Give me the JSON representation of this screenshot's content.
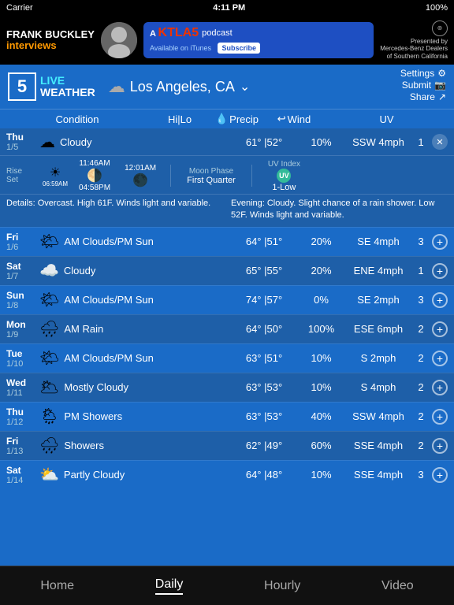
{
  "statusBar": {
    "carrier": "Carrier",
    "time": "4:11 PM",
    "battery": "100%"
  },
  "banner": {
    "frankBuckley": "FRANK BUCKLEY",
    "interviews": "interviews",
    "podcast": "podcast",
    "availableOn": "Available on iTunes",
    "subscribe": "Subscribe",
    "ktla": "KTLA",
    "presented": "Presented by",
    "mercedes": "Mercedes-Benz Dealers",
    "southern": "of Southern California"
  },
  "liveWeather": {
    "channel": "5",
    "live": "LIVE",
    "weather": "WEATHER",
    "location": "Los Angeles, CA",
    "settings": "Settings",
    "submit": "Submit",
    "share": "Share"
  },
  "columns": {
    "condition": "Condition",
    "hilo": "Hi|Lo",
    "precip": "Precip",
    "wind": "Wind",
    "uv": "UV"
  },
  "today": {
    "dayName": "Thu",
    "dayDate": "1/5",
    "condition": "Cloudy",
    "hiLo": "61° |52°",
    "precip": "10%",
    "wind": "SSW 4mph",
    "uv": "1",
    "sunrise": "06:59AM",
    "sunset": "04:58PM",
    "moonrise": "11:46AM",
    "moonset": "12:01AM",
    "moonPhase": "Moon Phase",
    "moonPhaseType": "First Quarter",
    "uvIndex": "UV Index",
    "uvValue": "1-Low"
  },
  "details": {
    "morning": "Details: Overcast. High 61F. Winds light and variable.",
    "evening": "Evening: Cloudy. Slight chance of a rain shower. Low 52F. Winds light and variable."
  },
  "forecast": [
    {
      "dayName": "Fri",
      "dayDate": "1/6",
      "condition": "AM Clouds/PM Sun",
      "icon": "🌤",
      "hiLo": "64° |51°",
      "precip": "20%",
      "wind": "SE 4mph",
      "uv": "3"
    },
    {
      "dayName": "Sat",
      "dayDate": "1/7",
      "condition": "Cloudy",
      "icon": "☁️",
      "hiLo": "65° |55°",
      "precip": "20%",
      "wind": "ENE 4mph",
      "uv": "1"
    },
    {
      "dayName": "Sun",
      "dayDate": "1/8",
      "condition": "AM Clouds/PM Sun",
      "icon": "🌤",
      "hiLo": "74° |57°",
      "precip": "0%",
      "wind": "SE 2mph",
      "uv": "3"
    },
    {
      "dayName": "Mon",
      "dayDate": "1/9",
      "condition": "AM Rain",
      "icon": "🌧",
      "hiLo": "64° |50°",
      "precip": "100%",
      "wind": "ESE 6mph",
      "uv": "2"
    },
    {
      "dayName": "Tue",
      "dayDate": "1/10",
      "condition": "AM Clouds/PM Sun",
      "icon": "🌤",
      "hiLo": "63° |51°",
      "precip": "10%",
      "wind": "S 2mph",
      "uv": "2"
    },
    {
      "dayName": "Wed",
      "dayDate": "1/11",
      "condition": "Mostly Cloudy",
      "icon": "🌥",
      "hiLo": "63° |53°",
      "precip": "10%",
      "wind": "S 4mph",
      "uv": "2"
    },
    {
      "dayName": "Thu",
      "dayDate": "1/12",
      "condition": "PM Showers",
      "icon": "🌦",
      "hiLo": "63° |53°",
      "precip": "40%",
      "wind": "SSW 4mph",
      "uv": "2"
    },
    {
      "dayName": "Fri",
      "dayDate": "1/13",
      "condition": "Showers",
      "icon": "🌧",
      "hiLo": "62° |49°",
      "precip": "60%",
      "wind": "SSE 4mph",
      "uv": "2"
    },
    {
      "dayName": "Sat",
      "dayDate": "1/14",
      "condition": "Partly Cloudy",
      "icon": "⛅",
      "hiLo": "64° |48°",
      "precip": "10%",
      "wind": "SSE 4mph",
      "uv": "3"
    }
  ],
  "nav": {
    "home": "Home",
    "daily": "Daily",
    "hourly": "Hourly",
    "video": "Video"
  }
}
